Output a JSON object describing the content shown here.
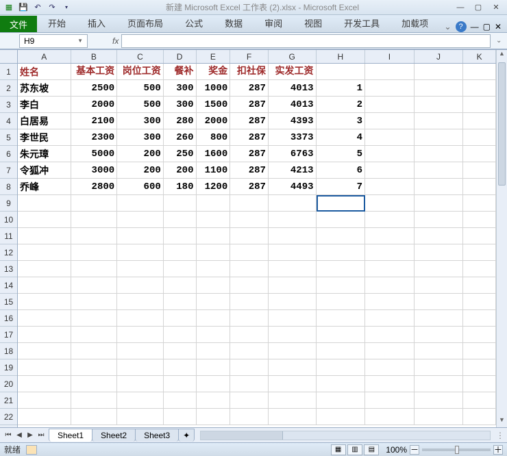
{
  "title": "新建 Microsoft Excel 工作表 (2).xlsx - Microsoft Excel",
  "ribbon": {
    "file": "文件",
    "tabs": [
      "开始",
      "插入",
      "页面布局",
      "公式",
      "数据",
      "审阅",
      "视图",
      "开发工具",
      "加载项"
    ]
  },
  "namebox": "H9",
  "columns": [
    "A",
    "B",
    "C",
    "D",
    "E",
    "F",
    "G",
    "H",
    "I",
    "J",
    "K"
  ],
  "row_count": 22,
  "selected_cell": {
    "row": 9,
    "col": "H"
  },
  "headers": [
    "姓名",
    "基本工资",
    "岗位工资",
    "餐补",
    "奖金",
    "扣社保",
    "实发工资"
  ],
  "rows": [
    {
      "name": "苏东坡",
      "base": 2500,
      "post": 500,
      "meal": 300,
      "bonus": 1000,
      "ins": 287,
      "net": 4013,
      "idx": 1
    },
    {
      "name": "李白",
      "base": 2000,
      "post": 500,
      "meal": 300,
      "bonus": 1500,
      "ins": 287,
      "net": 4013,
      "idx": 2
    },
    {
      "name": "白居易",
      "base": 2100,
      "post": 300,
      "meal": 280,
      "bonus": 2000,
      "ins": 287,
      "net": 4393,
      "idx": 3
    },
    {
      "name": "李世民",
      "base": 2300,
      "post": 300,
      "meal": 260,
      "bonus": 800,
      "ins": 287,
      "net": 3373,
      "idx": 4
    },
    {
      "name": "朱元璋",
      "base": 5000,
      "post": 200,
      "meal": 250,
      "bonus": 1600,
      "ins": 287,
      "net": 6763,
      "idx": 5
    },
    {
      "name": "令狐冲",
      "base": 3000,
      "post": 200,
      "meal": 200,
      "bonus": 1100,
      "ins": 287,
      "net": 4213,
      "idx": 6
    },
    {
      "name": "乔峰",
      "base": 2800,
      "post": 600,
      "meal": 180,
      "bonus": 1200,
      "ins": 287,
      "net": 4493,
      "idx": 7
    }
  ],
  "sheets": [
    "Sheet1",
    "Sheet2",
    "Sheet3"
  ],
  "active_sheet": 0,
  "status": {
    "ready": "就绪",
    "zoom": "100%"
  },
  "icons": {
    "plus": "＋",
    "minus": "－",
    "expand": "⌄"
  }
}
